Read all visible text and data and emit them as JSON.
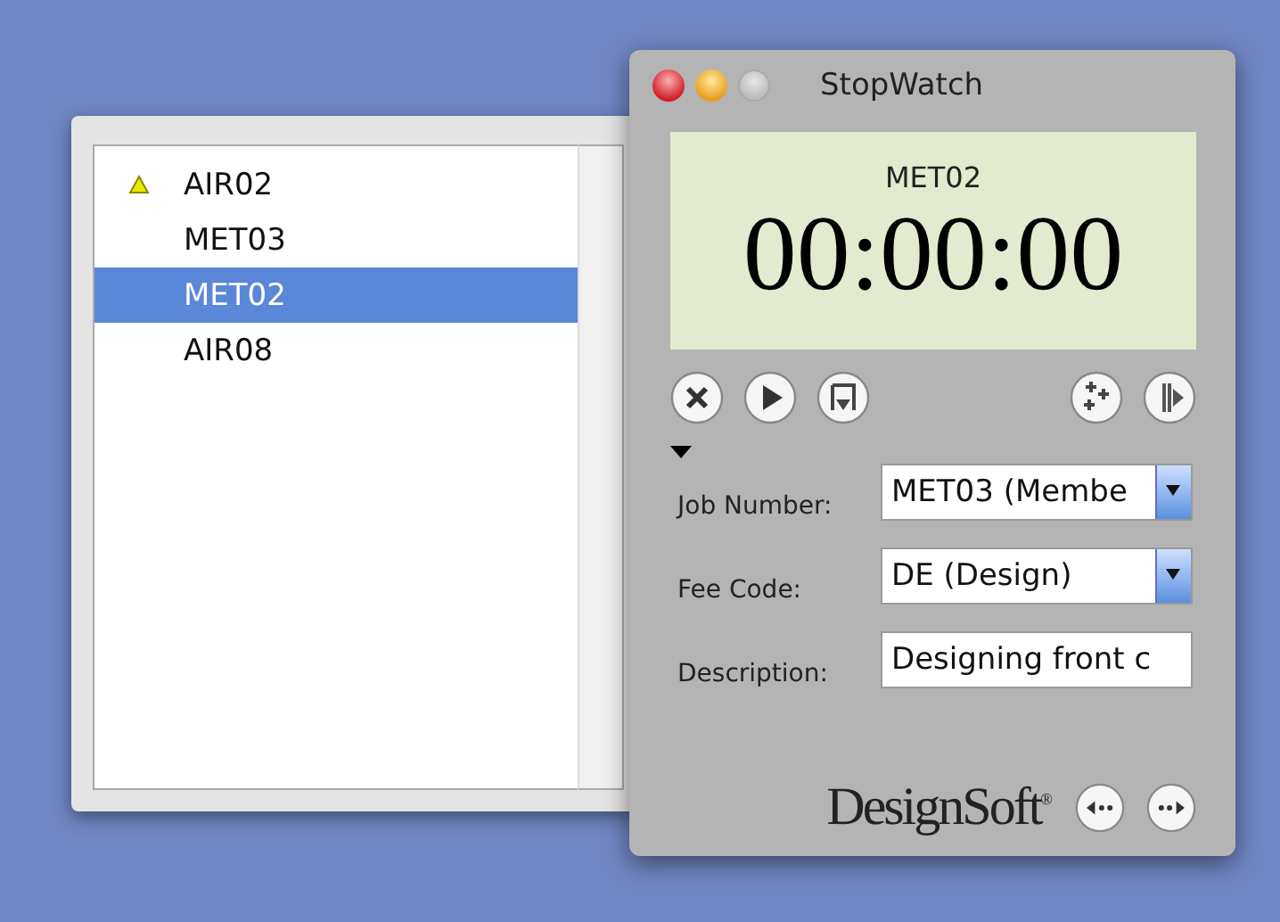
{
  "job_list": {
    "items": [
      {
        "label": "AIR02",
        "warning": true,
        "selected": false
      },
      {
        "label": "MET03",
        "warning": false,
        "selected": false
      },
      {
        "label": "MET02",
        "warning": false,
        "selected": true
      },
      {
        "label": "AIR08",
        "warning": false,
        "selected": false
      }
    ]
  },
  "stopwatch": {
    "window": {
      "title": "StopWatch",
      "zoom_disabled": true
    },
    "display": {
      "job": "MET02",
      "time": "00:00:00"
    },
    "details": {
      "expanded": true,
      "fields": [
        {
          "kind": "dropdown",
          "label": "Job Number:",
          "value": "MET03 (Membe"
        },
        {
          "kind": "dropdown",
          "label": "Fee Code:",
          "value": "DE (Design)"
        },
        {
          "kind": "text",
          "label": "Description:",
          "value": "Designing front c"
        }
      ]
    },
    "logo": "DesignSoft$^{®}$"
  }
}
